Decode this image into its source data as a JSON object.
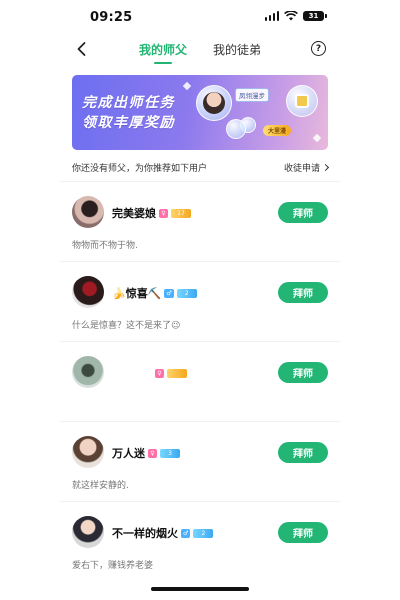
{
  "status_bar": {
    "time": "09:25",
    "battery": "31"
  },
  "nav": {
    "tabs": [
      {
        "label": "我的师父",
        "active": true
      },
      {
        "label": "我的徒弟",
        "active": false
      }
    ],
    "help_icon": "?"
  },
  "banner": {
    "line1": "完成出师任务",
    "line2": "领取丰厚奖励",
    "chip_text": "凤翎漫步",
    "gold_tag": "大里漫"
  },
  "info": {
    "text": "你还没有师父，为你推荐如下用户",
    "apply_label": "收徒申请"
  },
  "users": [
    {
      "name": "完美婆娘",
      "gender": "female",
      "gender_symbol": "♀",
      "level_color": "gold",
      "level_text": "17",
      "bio": "物物而不物于物.",
      "button": "拜师"
    },
    {
      "name": "🍌惊喜⛏️",
      "gender": "male",
      "gender_symbol": "♂",
      "level_color": "blue",
      "level_text": "2",
      "bio": "什么是惊喜？这不是来了😉",
      "button": "拜师"
    },
    {
      "name": "",
      "gender": "female",
      "gender_symbol": "♀",
      "level_color": "gold",
      "level_text": "",
      "bio": "",
      "button": "拜师"
    },
    {
      "name": "万人迷",
      "gender": "female",
      "gender_symbol": "♀",
      "level_color": "blue",
      "level_text": "3",
      "bio": "就这样安静的.",
      "button": "拜师"
    },
    {
      "name": "不一样的烟火",
      "gender": "male",
      "gender_symbol": "♂",
      "level_color": "blue",
      "level_text": "2",
      "bio": "爱右下，赚钱养老婆",
      "button": "拜师"
    }
  ],
  "colors": {
    "accent": "#22b573",
    "female": "#ff6fa8",
    "male": "#4ab0ff"
  },
  "icons": {
    "back": "chevron-left-icon",
    "help": "question-circle-icon",
    "apply_arrow": "chevron-right-icon"
  }
}
